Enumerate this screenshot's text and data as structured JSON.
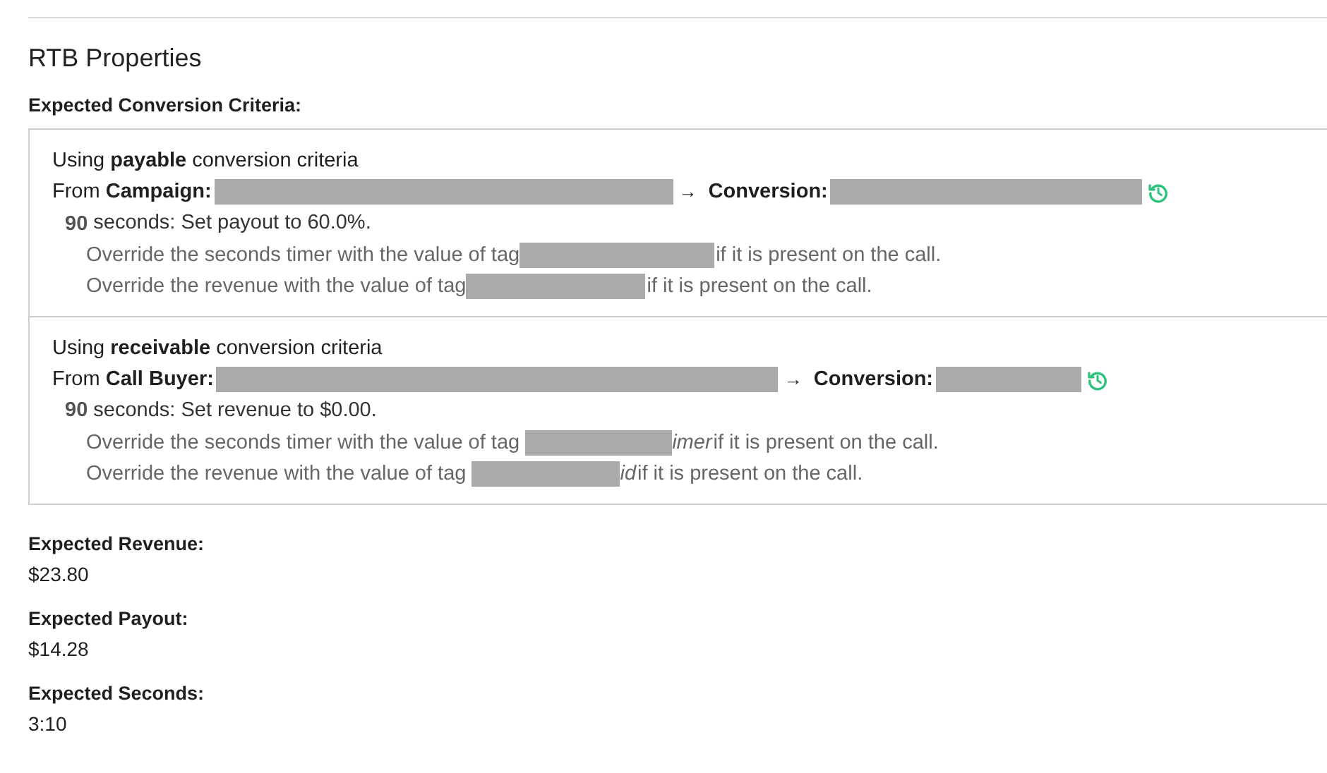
{
  "title": "RTB Properties",
  "criteria_heading": "Expected Conversion Criteria:",
  "criteria": [
    {
      "intro": "Using **payable** conversion criteria",
      "from_label": "From",
      "source_label": "Campaign:",
      "arrow": "→",
      "conversion_label": "Conversion:",
      "rule": "**90** seconds: Set payout to 60.0%.",
      "overrides": [
        {
          "text": "Override the seconds timer with the value of tag",
          "suffix": "if it is present on the call."
        },
        {
          "text": "Override the revenue with the value of tag",
          "suffix": "if it is present on the call."
        }
      ]
    },
    {
      "intro": "Using **receivable** conversion criteria",
      "from_label": "From",
      "source_label": "Call Buyer:",
      "arrow": "→",
      "conversion_label": "Conversion:",
      "rule": "**90** seconds: Set revenue to $0.00.",
      "overrides": [
        {
          "text": "Override the seconds timer with the value of tag",
          "tag_tail": "imer",
          "suffix": "if it is present on the call."
        },
        {
          "text": "Override the revenue with the value of tag",
          "tag_tail": "id",
          "suffix": "if it is present on the call."
        }
      ]
    }
  ],
  "fields": [
    {
      "label": "Expected Revenue:",
      "value": "$23.80"
    },
    {
      "label": "Expected Payout:",
      "value": "$14.28"
    },
    {
      "label": "Expected Seconds:",
      "value": "3:10"
    }
  ]
}
